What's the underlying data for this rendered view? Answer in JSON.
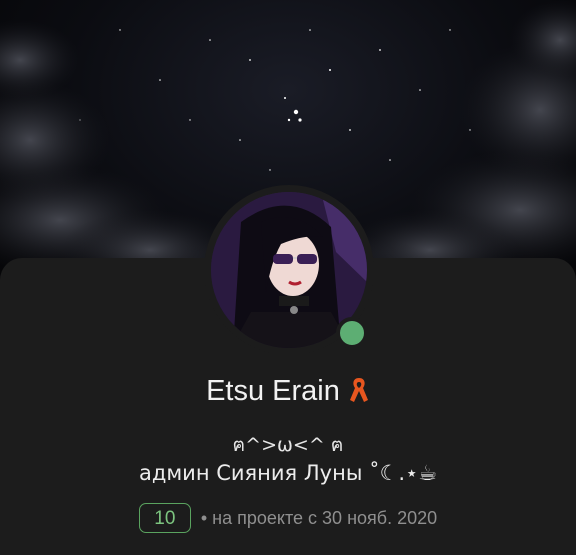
{
  "profile": {
    "display_name": "Etsu Erain",
    "name_badge_icon": "orange-ribbon-icon",
    "status_line": "ฅ^>ω<^ ฅ",
    "bio": "админ Сияния Луны ˚☾.⋆☕",
    "online": true,
    "level": "10",
    "member_since": "• на проекте с 30 нояб. 2020"
  },
  "colors": {
    "background": "#1c1c1c",
    "online_dot": "#5dae73",
    "level_border": "#5aa35f",
    "level_text": "#7cc47f",
    "ribbon": "#e8561f"
  }
}
